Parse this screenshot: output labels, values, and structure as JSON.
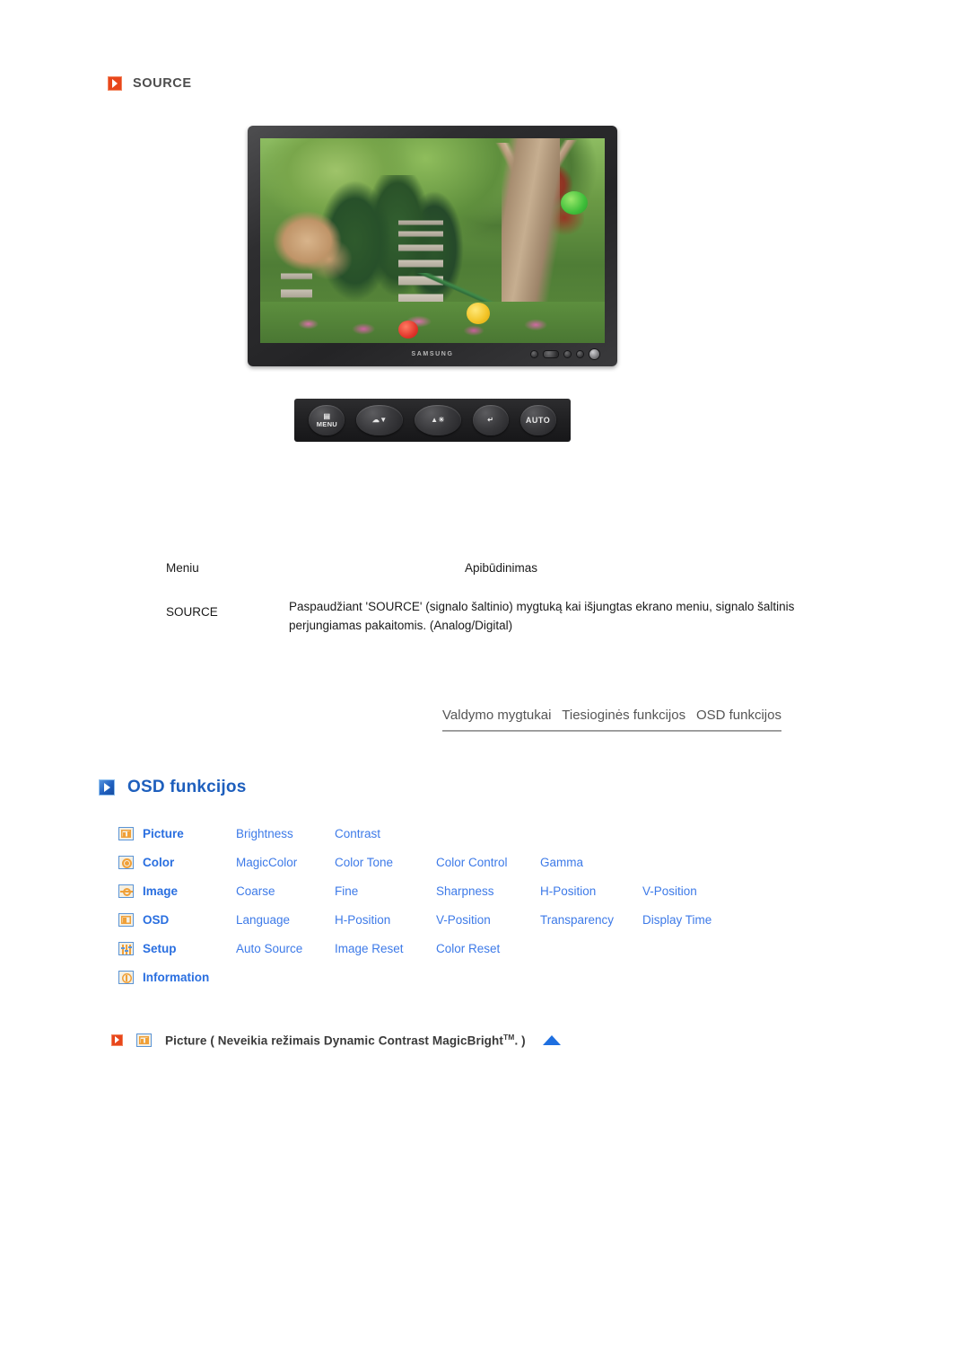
{
  "source_section": {
    "icon": "orange-arrow-icon",
    "title": "SOURCE"
  },
  "monitor": {
    "brand_logo": "SAMSUNG",
    "screen_content": "garden scene with stone pagoda, trees and paper lanterns"
  },
  "control_buttons": [
    {
      "name": "menu-button",
      "glyph": "▤",
      "label": "MENU"
    },
    {
      "name": "down-button",
      "glyph": "☁▼",
      "label": ""
    },
    {
      "name": "brightness-button",
      "glyph": "▲☀",
      "label": ""
    },
    {
      "name": "enter-button",
      "glyph": "↵",
      "label": ""
    },
    {
      "name": "auto-button",
      "glyph": "",
      "label": "AUTO"
    }
  ],
  "description_table": {
    "headers": {
      "menu": "Meniu",
      "description": "Apibūdinimas"
    },
    "rows": [
      {
        "menu": "SOURCE",
        "description": "Paspaudžiant 'SOURCE' (signalo šaltinio) mygtuką kai išjungtas ekrano meniu, signalo šaltinis perjungiamas pakaitomis. (Analog/Digital)"
      }
    ]
  },
  "tabs": [
    {
      "label": "Valdymo mygtukai"
    },
    {
      "label": "Tiesioginės funkcijos"
    },
    {
      "label": "OSD funkcijos"
    }
  ],
  "osd_section": {
    "icon": "blue-arrow-icon",
    "title": "OSD funkcijos",
    "rows": [
      {
        "icon": "picture-icon",
        "category": "Picture",
        "items": [
          "Brightness",
          "Contrast"
        ]
      },
      {
        "icon": "color-icon",
        "category": "Color",
        "items": [
          "MagicColor",
          "Color Tone",
          "Color Control",
          "Gamma"
        ]
      },
      {
        "icon": "image-icon",
        "category": "Image",
        "items": [
          "Coarse",
          "Fine",
          "Sharpness",
          "H-Position",
          "V-Position"
        ]
      },
      {
        "icon": "osd-icon",
        "category": "OSD",
        "items": [
          "Language",
          "H-Position",
          "V-Position",
          "Transparency",
          "Display Time"
        ]
      },
      {
        "icon": "setup-icon",
        "category": "Setup",
        "items": [
          "Auto Source",
          "Image Reset",
          "Color Reset"
        ]
      },
      {
        "icon": "information-icon",
        "category": "Information",
        "items": []
      }
    ]
  },
  "picture_note": {
    "bullet_icon": "orange-arrow-icon",
    "menu_icon": "picture-icon",
    "text_before": "Picture ( Neveikia režimais Dynamic Contrast MagicBright",
    "superscript": "TM",
    "text_after": ". )",
    "back_to_top_icon": "up-triangle-icon"
  },
  "colors": {
    "accent_orange": "#e8461b",
    "accent_blue": "#1e5fbd",
    "link_blue": "#3d7ae8",
    "icon_orange": "#f0a038",
    "text_dark": "#1a1a1a"
  }
}
